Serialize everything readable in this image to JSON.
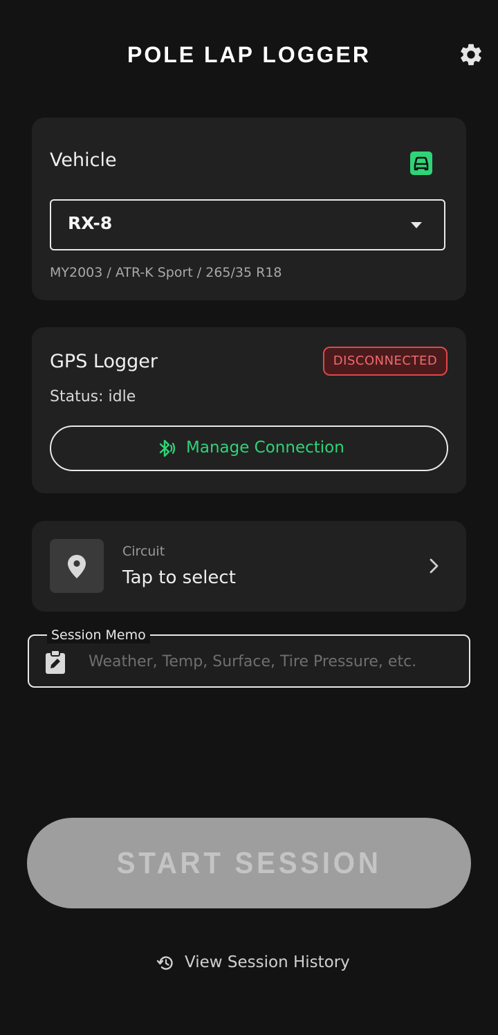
{
  "header": {
    "title": "POLE LAP LOGGER",
    "settings_icon": "gear-icon"
  },
  "vehicle": {
    "label": "Vehicle",
    "icon": "car-icon",
    "selected": "RX-8",
    "details": "MY2003 / ATR-K Sport / 265/35 R18"
  },
  "gps": {
    "title": "GPS Logger",
    "badge": "DISCONNECTED",
    "status": "Status: idle",
    "manage_label": "Manage Connection"
  },
  "circuit": {
    "label": "Circuit",
    "value": "Tap to select"
  },
  "memo": {
    "legend": "Session Memo",
    "placeholder": "Weather, Temp, Surface, Tire Pressure, etc.",
    "value": ""
  },
  "start": {
    "label": "START SESSION"
  },
  "history": {
    "label": "View Session History"
  },
  "colors": {
    "background": "#131313",
    "card": "#212121",
    "accent_green": "#2ed477",
    "error_red": "#e04848",
    "disabled_button": "#9e9e9e"
  }
}
